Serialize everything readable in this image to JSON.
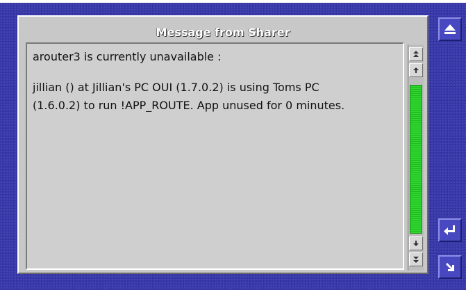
{
  "window": {
    "title": "Message from Sharer"
  },
  "message": {
    "line1": "arouter3 is currently unavailable :",
    "line2": "jillian () at Jillian's PC OUI (1.7.0.2) is using Toms PC",
    "line3": "(1.6.0.2) to run !APP_ROUTE. App unused for 0 minutes."
  },
  "scrollbar": {
    "position_fraction": 0.0,
    "visible_fraction": 1.0
  },
  "icons": {
    "scroll_top": "double-up-arrow",
    "scroll_up": "up-arrow",
    "scroll_down": "down-arrow",
    "scroll_bottom": "double-down-arrow",
    "eject": "eject-icon",
    "enter": "return-arrow-icon",
    "resize": "resize-corner-arrow-icon"
  },
  "colors": {
    "frame": "#3838a8",
    "panel": "#c8c8c8",
    "scroll_track": "#2ed62e"
  }
}
